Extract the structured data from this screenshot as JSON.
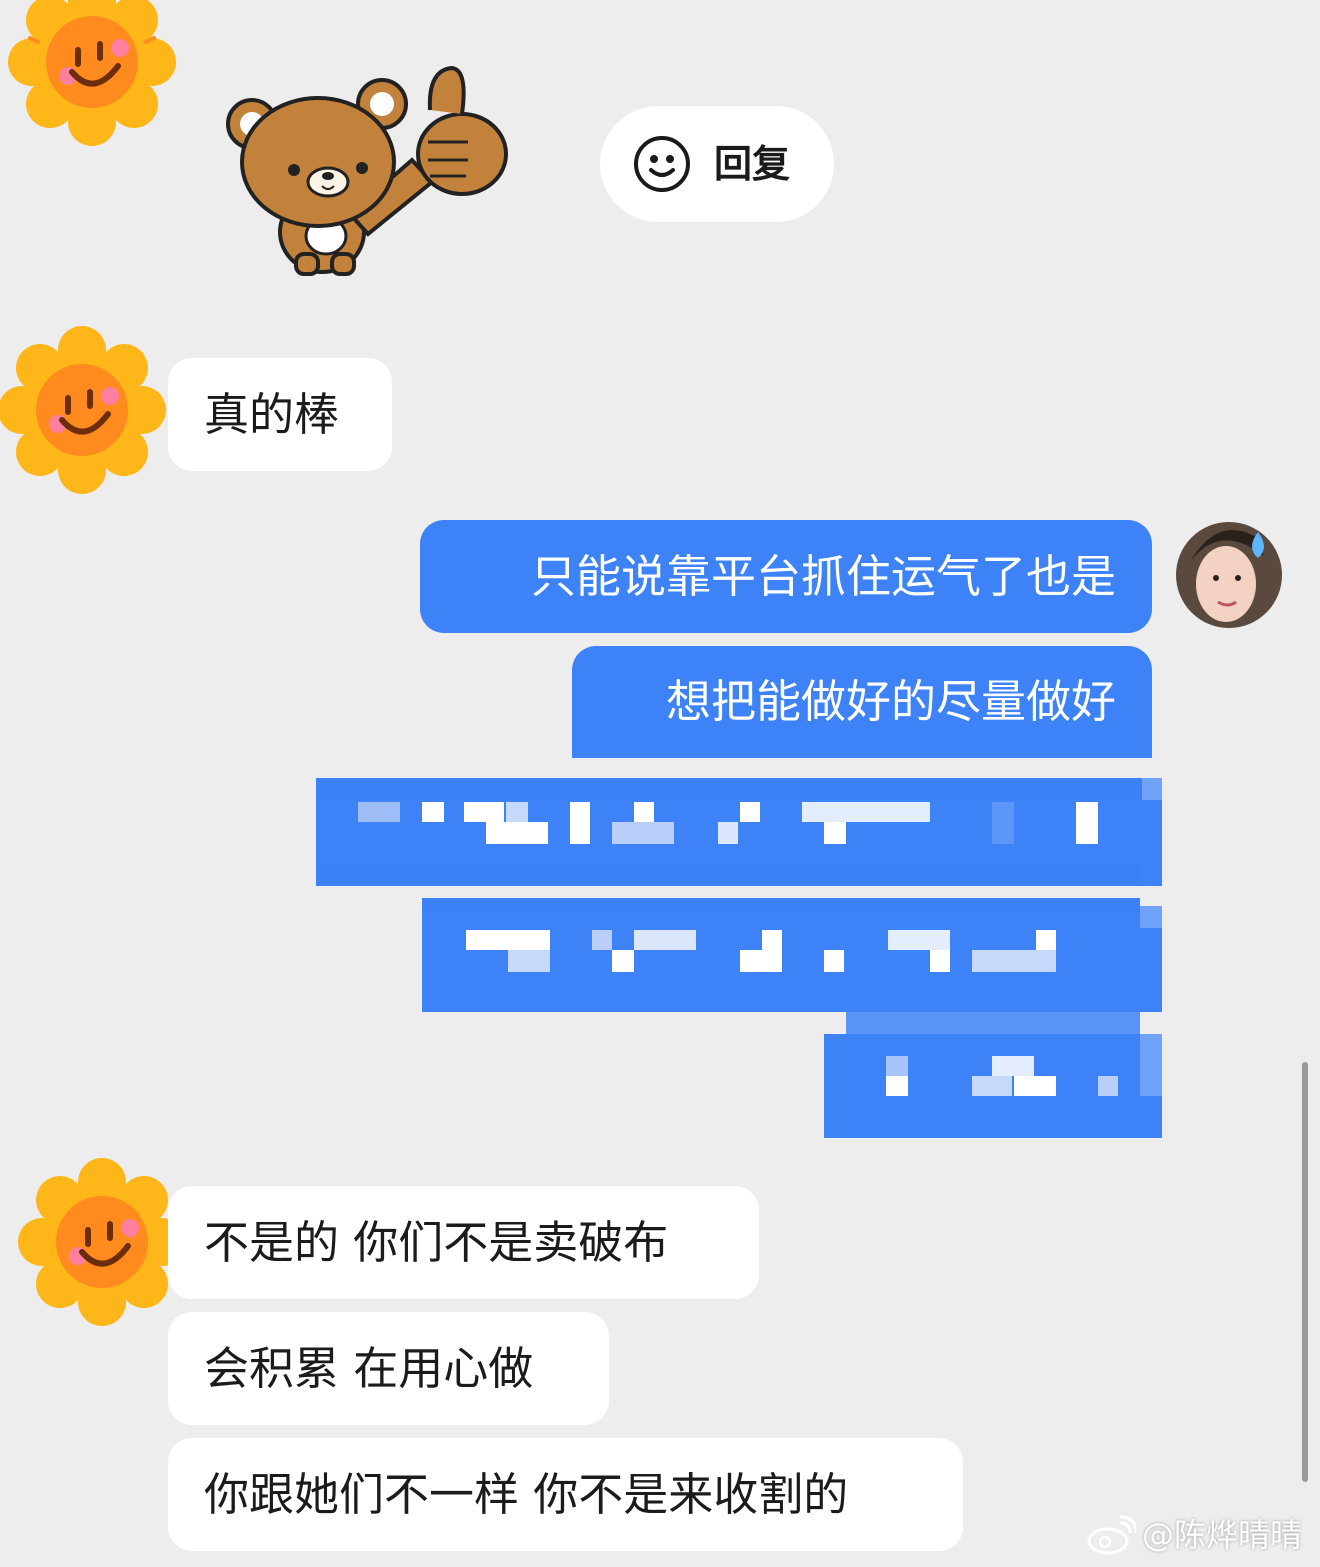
{
  "reply": {
    "label": "回复",
    "icon": "smile-face-icon"
  },
  "messages": [
    {
      "sender": "other",
      "text": "真的棒"
    },
    {
      "sender": "self",
      "text": "只能说靠平台抓住运气了也是"
    },
    {
      "sender": "self",
      "text": "想把能做好的尽量做好"
    },
    {
      "sender": "other",
      "text": "不是的 你们不是卖破布"
    },
    {
      "sender": "other",
      "text": "会积累 在用心做"
    },
    {
      "sender": "other",
      "text": "你跟她们不一样 你不是来收割的"
    }
  ],
  "watermark": {
    "text": "@陈烨晴晴",
    "icon": "weibo-logo-icon"
  },
  "colors": {
    "background": "#ededed",
    "outgoing_bubble": "#3d82f7",
    "incoming_bubble": "#ffffff"
  }
}
